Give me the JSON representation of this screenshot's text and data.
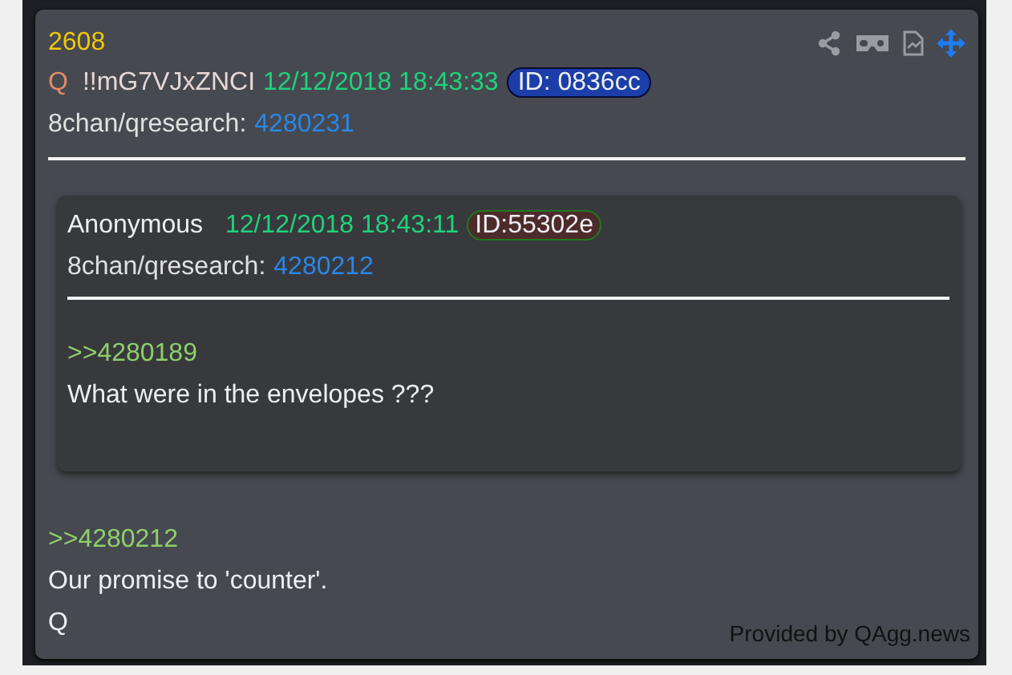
{
  "post": {
    "number": "2608",
    "author": "Q",
    "tripcode": "!!mG7VJxZNCI",
    "timestamp": "12/12/2018 18:43:33",
    "id_badge": "ID: 0836cc",
    "source": {
      "label": "8chan/qresearch:",
      "link": "4280231"
    },
    "quoted_post": {
      "author": "Anonymous",
      "timestamp": "12/12/2018 18:43:11",
      "id_badge": "ID:55302e",
      "source": {
        "label": "8chan/qresearch:",
        "link": "4280212"
      },
      "body": [
        {
          "kind": "reply_link",
          "text": ">>4280189"
        },
        {
          "kind": "text",
          "text": "What were in the envelopes ???"
        }
      ]
    },
    "body": [
      {
        "kind": "reply_link",
        "text": ">>4280212"
      },
      {
        "kind": "text",
        "text": "Our promise to 'counter'."
      },
      {
        "kind": "text",
        "text": "Q"
      }
    ],
    "credit": "Provided by QAgg.news"
  }
}
